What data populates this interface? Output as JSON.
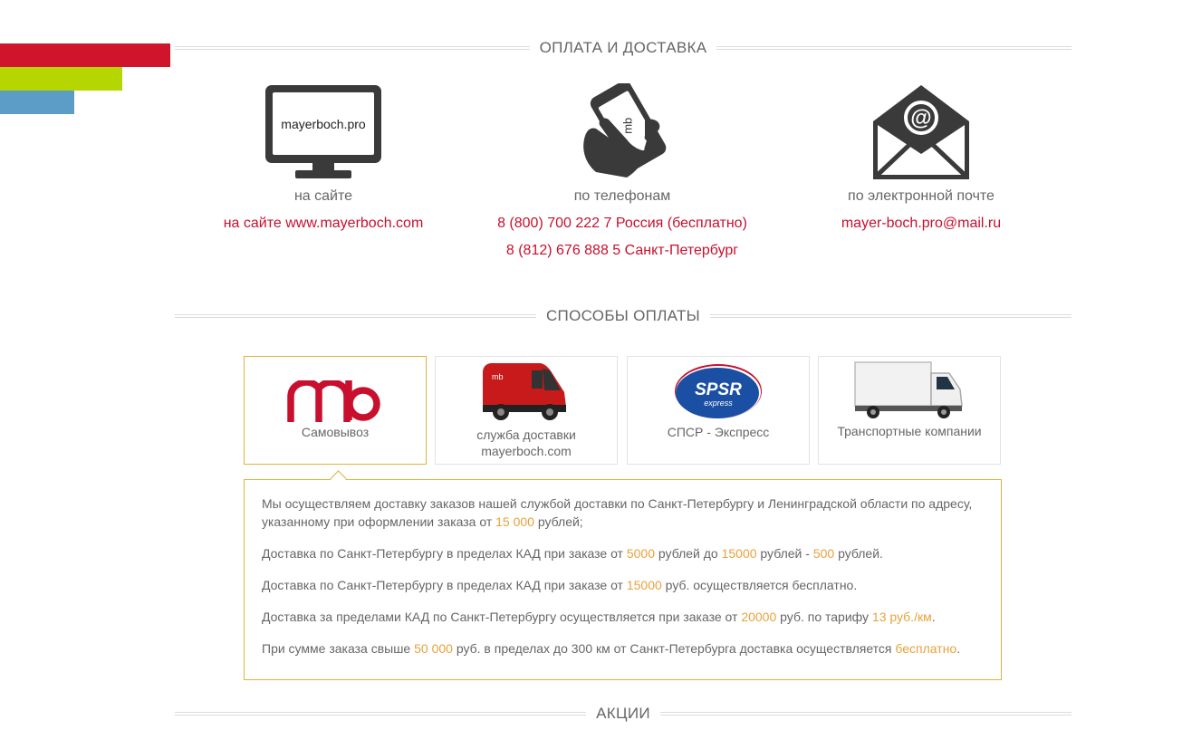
{
  "headings": {
    "payment_delivery": "ОПЛАТА И ДОСТАВКА",
    "payment_methods": "СПОСОБЫ ОПЛАТЫ",
    "promotions": "АКЦИИ"
  },
  "contacts": {
    "site": {
      "icon": "monitor-icon",
      "screen_text": "mayerboch.pro",
      "label": "на сайте",
      "value": "на сайте www.mayerboch.com"
    },
    "phone": {
      "icon": "phone-hand-icon",
      "label": "по телефонам",
      "values": [
        "8 (800) 700 222 7 Россия (бесплатно)",
        "8 (812) 676 888 5 Санкт-Петербург"
      ]
    },
    "email": {
      "icon": "envelope-icon",
      "label": "по электронной почте",
      "value": "mayer-boch.pro@mail.ru"
    }
  },
  "payment_cards": [
    {
      "label": "Самовывоз",
      "icon": "mb-logo",
      "active": true
    },
    {
      "label": "служба доставки mayerboch.com",
      "icon": "red-van-icon",
      "active": false
    },
    {
      "label": "СПСР - Экспресс",
      "icon": "spsr-logo",
      "logo_text_1": "SPSR",
      "logo_text_2": "express",
      "active": false
    },
    {
      "label": "Транспортные компании",
      "icon": "truck-icon",
      "active": false
    }
  ],
  "delivery_info": {
    "p1": {
      "a": "Мы осуществляем доставку заказов нашей службой доставки по Санкт-Петербургу и Ленинградской области по адресу, указанному при оформлении заказа от ",
      "amount": "15 000",
      "b": " рублей;"
    },
    "p2": {
      "a": "Доставка по Санкт-Петербургу в пределах КАД при заказе от ",
      "from": "5000",
      "b": " рублей до ",
      "to": "15000",
      "c": " рублей - ",
      "price": "500",
      "d": " рублей."
    },
    "p3": {
      "a": "Доставка по Санкт-Петербургу в пределах КАД при заказе от ",
      "amount": "15000",
      "b": " руб. осуществляется бесплатно."
    },
    "p4": {
      "a": "Доставка за пределами КАД по Санкт-Петербургу осуществляется при заказе от ",
      "amount": "20000",
      "b": " руб. по тарифу ",
      "rate": "13 руб./км",
      "c": "."
    },
    "p5": {
      "a": "При сумме заказа свыше ",
      "amount": "50 000",
      "b": " руб. в пределах до 300 км от Санкт-Петербурга доставка осуществляется ",
      "free": "бесплатно",
      "c": "."
    }
  },
  "colors": {
    "accent_red": "#c8102e",
    "highlight_orange": "#e8a23b",
    "border_gold": "#e0b33a",
    "stripe_red": "#d0142c",
    "stripe_green": "#b5d600",
    "stripe_blue": "#5b9dc7"
  }
}
